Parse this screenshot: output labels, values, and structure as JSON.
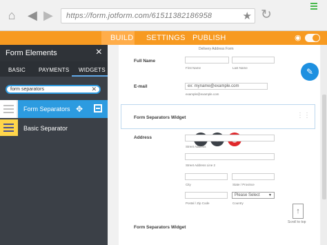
{
  "browser": {
    "url": "https://form.jotform.com/61511382186958",
    "icons": [
      "home-icon",
      "back-arrow-icon",
      "forward-arrow-icon",
      "star-icon",
      "reload-icon",
      "menu-icon"
    ]
  },
  "topnav": {
    "tabs": [
      "BUILD",
      "SETTINGS",
      "PUBLISH"
    ],
    "active_tab": "BUILD",
    "accent_color": "#f79a21"
  },
  "sidebar": {
    "title": "Form Elements",
    "tabs": [
      "BASIC",
      "PAYMENTS",
      "WIDGETS"
    ],
    "active_tab": "WIDGETS",
    "search_value": "form separators",
    "items": [
      {
        "label": "Form Separators"
      },
      {
        "label": "Basic Separator"
      }
    ],
    "selected_color": "#2c9be0"
  },
  "form": {
    "header_text": "Delivery Address Form",
    "full_name": {
      "label": "Full Name",
      "sub_first": "First Name",
      "sub_last": "Last Name"
    },
    "email": {
      "label": "E-mail",
      "placeholder": "ex: myname@example.com",
      "sub": "example@example.com"
    },
    "widget_title": "Form Separators Widget",
    "address": {
      "label": "Address",
      "street": "Street Address",
      "street2": "Street Address Line 2",
      "city": "City",
      "state": "State / Province",
      "postal": "Postal / Zip Code",
      "country_select": "Please Select",
      "country_label": "Country"
    },
    "widget_title_2": "Form Separators Widget",
    "scroll_top_label": "Scroll to top"
  }
}
